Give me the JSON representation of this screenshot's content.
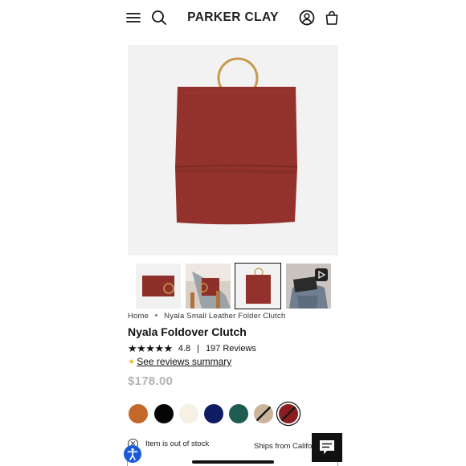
{
  "header": {
    "brand": "PARKER CLAY",
    "icons": [
      "menu-icon",
      "search-icon",
      "account-icon",
      "cart-icon"
    ]
  },
  "product_images": {
    "thumbnails": [
      "bag-flat-thumb",
      "bag-in-use-thumb",
      "bag-upright-thumb",
      "bag-video-thumb"
    ],
    "active_thumbnail": 3
  },
  "breadcrumb": {
    "home": "Home",
    "current": "Nyala Small Leather Folder Clutch"
  },
  "product": {
    "title": "Nyala Foldover Clutch",
    "rating": 4.8,
    "rating_text": "4.8",
    "separator": "|",
    "reviews": "197 Reviews",
    "reviews_summary_link": "See reviews summary",
    "price": "$178.00"
  },
  "swatches": {
    "colors": [
      "#c2692a",
      "#050505",
      "#f7f1e4",
      "#0f1b63",
      "#1e5c52",
      "#c8b59a",
      "#8c1c1f"
    ],
    "selected_index": 6
  },
  "availability": {
    "stock_text": "Item is out of stock",
    "ships_text": "Ships from Califo"
  },
  "colors": {
    "bag": "#93322c",
    "handle": "#c89a4c",
    "price_gray": "#b3b3b3",
    "accessibility_blue": "#1a5ad8"
  }
}
